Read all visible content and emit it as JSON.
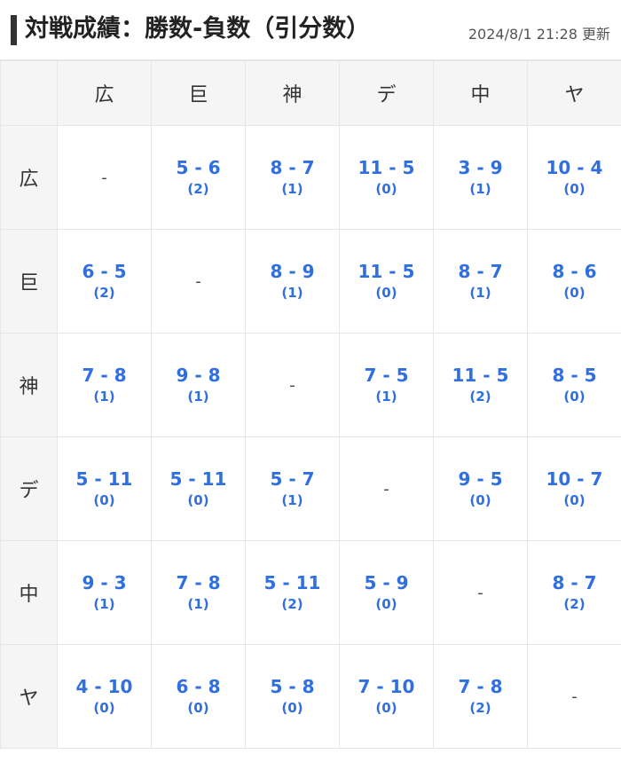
{
  "header": {
    "title": "対戦成績：勝数-負数（引分数）",
    "updated": "2024/8/1 21:28 更新"
  },
  "colors": {
    "link": "#2f6fe0",
    "header_bg": "#f5f5f5",
    "border": "#e6e6e6"
  },
  "table": {
    "corner": "",
    "columns": [
      "広",
      "巨",
      "神",
      "デ",
      "中",
      "ヤ"
    ],
    "rows": [
      {
        "team": "広",
        "cells": [
          {
            "self": "-"
          },
          {
            "score": "5 - 6",
            "draws": "(2)"
          },
          {
            "score": "8 - 7",
            "draws": "(1)"
          },
          {
            "score": "11 - 5",
            "draws": "(0)"
          },
          {
            "score": "3 - 9",
            "draws": "(1)"
          },
          {
            "score": "10 - 4",
            "draws": "(0)"
          }
        ]
      },
      {
        "team": "巨",
        "cells": [
          {
            "score": "6 - 5",
            "draws": "(2)"
          },
          {
            "self": "-"
          },
          {
            "score": "8 - 9",
            "draws": "(1)"
          },
          {
            "score": "11 - 5",
            "draws": "(0)"
          },
          {
            "score": "8 - 7",
            "draws": "(1)"
          },
          {
            "score": "8 - 6",
            "draws": "(0)"
          }
        ]
      },
      {
        "team": "神",
        "cells": [
          {
            "score": "7 - 8",
            "draws": "(1)"
          },
          {
            "score": "9 - 8",
            "draws": "(1)"
          },
          {
            "self": "-"
          },
          {
            "score": "7 - 5",
            "draws": "(1)"
          },
          {
            "score": "11 - 5",
            "draws": "(2)"
          },
          {
            "score": "8 - 5",
            "draws": "(0)"
          }
        ]
      },
      {
        "team": "デ",
        "cells": [
          {
            "score": "5 - 11",
            "draws": "(0)"
          },
          {
            "score": "5 - 11",
            "draws": "(0)"
          },
          {
            "score": "5 - 7",
            "draws": "(1)"
          },
          {
            "self": "-"
          },
          {
            "score": "9 - 5",
            "draws": "(0)"
          },
          {
            "score": "10 - 7",
            "draws": "(0)"
          }
        ]
      },
      {
        "team": "中",
        "cells": [
          {
            "score": "9 - 3",
            "draws": "(1)"
          },
          {
            "score": "7 - 8",
            "draws": "(1)"
          },
          {
            "score": "5 - 11",
            "draws": "(2)"
          },
          {
            "score": "5 - 9",
            "draws": "(0)"
          },
          {
            "self": "-"
          },
          {
            "score": "8 - 7",
            "draws": "(2)"
          }
        ]
      },
      {
        "team": "ヤ",
        "cells": [
          {
            "score": "4 - 10",
            "draws": "(0)"
          },
          {
            "score": "6 - 8",
            "draws": "(0)"
          },
          {
            "score": "5 - 8",
            "draws": "(0)"
          },
          {
            "score": "7 - 10",
            "draws": "(0)"
          },
          {
            "score": "7 - 8",
            "draws": "(2)"
          },
          {
            "self": "-"
          }
        ]
      }
    ]
  }
}
